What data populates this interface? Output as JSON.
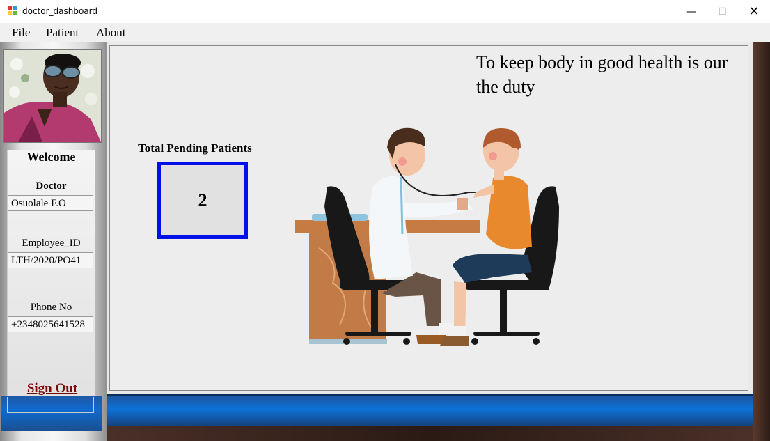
{
  "window": {
    "title": "doctor_dashboard"
  },
  "menu": [
    "File",
    "Patient",
    "About"
  ],
  "sidebar": {
    "welcome": "Welcome",
    "role_label": "Doctor",
    "doctor_name": "Osuolale F.O",
    "employee_id_label": "Employee_ID",
    "employee_id": "LTH/2020/PO41",
    "phone_label": "Phone No",
    "phone": "+2348025641528",
    "sign_out": "Sign Out"
  },
  "main": {
    "slogan": "To keep body in good health is our the duty",
    "pending_label": "Total Pending Patients",
    "pending_count": "2"
  },
  "colors": {
    "pending_border": "#0010e8",
    "sign_out": "#7a0a0a",
    "bar_blue": "#0c72d6"
  }
}
